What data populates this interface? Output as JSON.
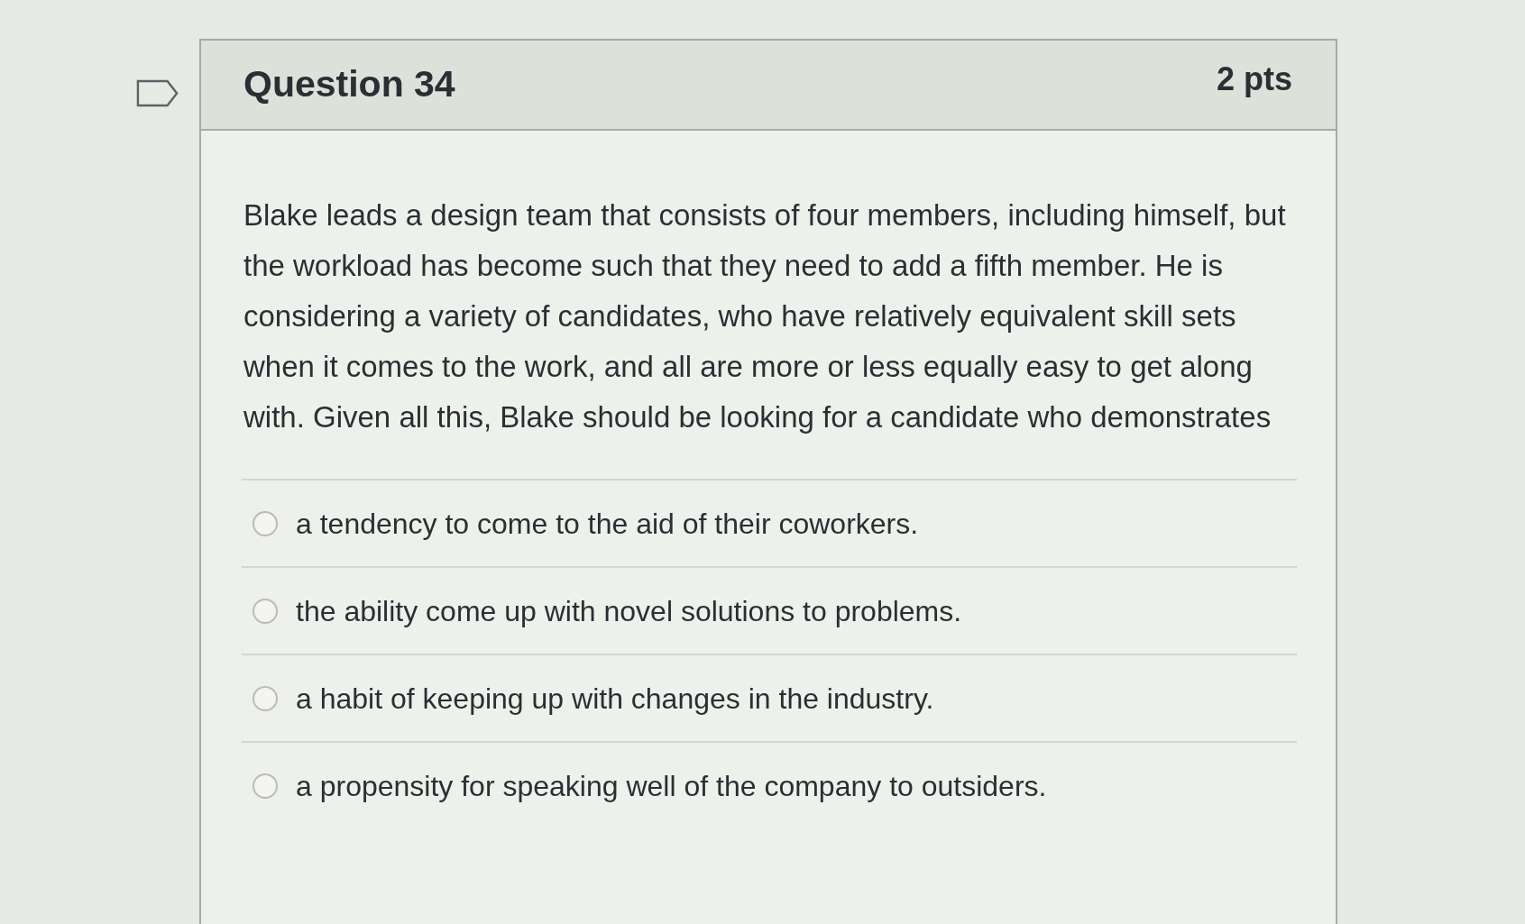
{
  "question": {
    "flagged": false,
    "title": "Question 34",
    "points": "2 pts",
    "text": "Blake leads a design team that consists of four members, including himself, but the workload has become such that they need to add a fifth member. He is considering a variety of candidates, who have relatively equivalent skill sets when it comes to the work, and all are more or less equally easy to get along with. Given all this, Blake should be looking for a candidate who demonstrates"
  },
  "answers": [
    {
      "label": "a tendency to come to the aid of their coworkers.",
      "selected": false
    },
    {
      "label": "the ability come up with novel solutions to problems.",
      "selected": false
    },
    {
      "label": "a habit of keeping up with changes in the industry.",
      "selected": false
    },
    {
      "label": "a propensity for speaking well of the company to outsiders.",
      "selected": false
    }
  ]
}
